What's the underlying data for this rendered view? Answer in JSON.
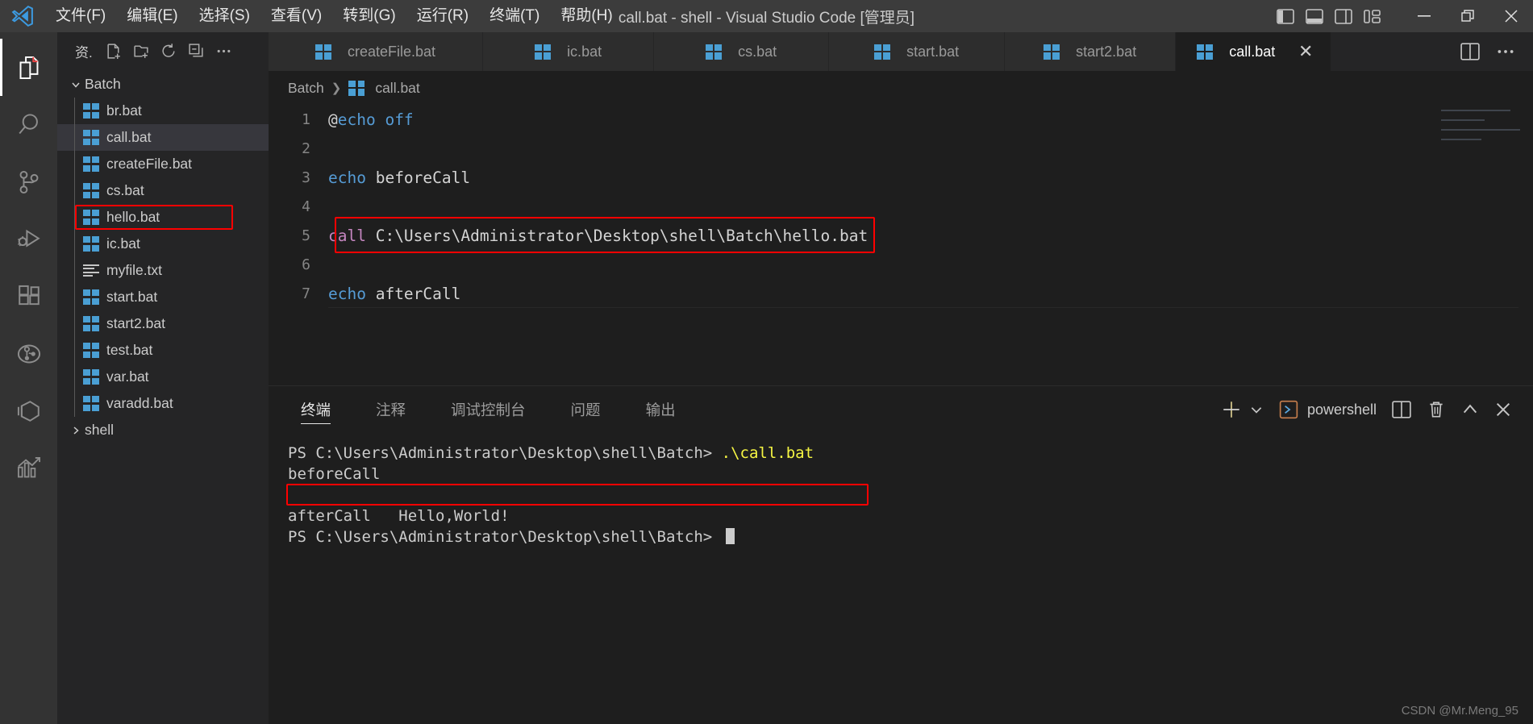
{
  "window": {
    "title": "call.bat - shell - Visual Studio Code [管理员]",
    "logo_icon": "vscode-logo-icon",
    "menus": [
      {
        "label": "文件(F)",
        "name": "menu-file"
      },
      {
        "label": "编辑(E)",
        "name": "menu-edit"
      },
      {
        "label": "选择(S)",
        "name": "menu-selection"
      },
      {
        "label": "查看(V)",
        "name": "menu-view"
      },
      {
        "label": "转到(G)",
        "name": "menu-go"
      },
      {
        "label": "运行(R)",
        "name": "menu-run"
      },
      {
        "label": "终端(T)",
        "name": "menu-terminal"
      },
      {
        "label": "帮助(H)",
        "name": "menu-help"
      }
    ],
    "layout_controls": [
      "toggle-primary-sidebar-icon",
      "toggle-panel-icon",
      "toggle-secondary-sidebar-icon",
      "customize-layout-icon"
    ],
    "window_controls": {
      "minimize": "−",
      "restore": "❐",
      "close": "✕"
    }
  },
  "activitybar": {
    "items": [
      {
        "name": "activity-explorer",
        "icon": "files-icon",
        "active": true
      },
      {
        "name": "activity-search",
        "icon": "search-icon",
        "active": false
      },
      {
        "name": "activity-source-control",
        "icon": "source-control-icon",
        "active": false
      },
      {
        "name": "activity-run-debug",
        "icon": "run-and-debug-icon",
        "active": false
      },
      {
        "name": "activity-extensions",
        "icon": "extensions-icon",
        "active": false
      },
      {
        "name": "activity-testing",
        "icon": "beaker-circle-icon",
        "active": false
      },
      {
        "name": "activity-remote",
        "icon": "cube-icon",
        "active": false
      },
      {
        "name": "activity-analytics",
        "icon": "graph-chart-icon",
        "active": false
      }
    ]
  },
  "sidebar": {
    "title": "资.",
    "actions": [
      {
        "name": "new-file-button",
        "icon": "new-file-icon"
      },
      {
        "name": "new-folder-button",
        "icon": "new-folder-icon"
      },
      {
        "name": "refresh-explorer-button",
        "icon": "refresh-icon"
      },
      {
        "name": "collapse-folders-button",
        "icon": "collapse-all-icon"
      },
      {
        "name": "explorer-more-actions-button",
        "icon": "ellipsis-icon"
      }
    ],
    "tree": [
      {
        "label": "Batch",
        "type": "folder",
        "expanded": true,
        "icon": "chevron-down-icon"
      },
      {
        "label": "br.bat",
        "type": "file",
        "icon": "bat-file-icon"
      },
      {
        "label": "call.bat",
        "type": "file",
        "icon": "bat-file-icon",
        "selected": true
      },
      {
        "label": "createFile.bat",
        "type": "file",
        "icon": "bat-file-icon"
      },
      {
        "label": "cs.bat",
        "type": "file",
        "icon": "bat-file-icon"
      },
      {
        "label": "hello.bat",
        "type": "file",
        "icon": "bat-file-icon",
        "highlighted": true
      },
      {
        "label": "ic.bat",
        "type": "file",
        "icon": "bat-file-icon"
      },
      {
        "label": "myfile.txt",
        "type": "file",
        "icon": "text-file-icon"
      },
      {
        "label": "start.bat",
        "type": "file",
        "icon": "bat-file-icon"
      },
      {
        "label": "start2.bat",
        "type": "file",
        "icon": "bat-file-icon"
      },
      {
        "label": "test.bat",
        "type": "file",
        "icon": "bat-file-icon"
      },
      {
        "label": "var.bat",
        "type": "file",
        "icon": "bat-file-icon"
      },
      {
        "label": "varadd.bat",
        "type": "file",
        "icon": "bat-file-icon"
      },
      {
        "label": "shell",
        "type": "folder",
        "expanded": false,
        "icon": "chevron-right-icon"
      }
    ]
  },
  "editor": {
    "tabs": [
      {
        "label": "createFile.bat",
        "icon": "bat-file-icon",
        "active": false
      },
      {
        "label": "ic.bat",
        "icon": "bat-file-icon",
        "active": false
      },
      {
        "label": "cs.bat",
        "icon": "bat-file-icon",
        "active": false
      },
      {
        "label": "start.bat",
        "icon": "bat-file-icon",
        "active": false
      },
      {
        "label": "start2.bat",
        "icon": "bat-file-icon",
        "active": false
      },
      {
        "label": "call.bat",
        "icon": "bat-file-icon",
        "active": true,
        "close": "✕"
      }
    ],
    "tab_actions": [
      {
        "name": "split-editor-button",
        "icon": "split-editor-icon"
      },
      {
        "name": "editor-more-actions-button",
        "icon": "ellipsis-icon"
      }
    ],
    "breadcrumb": {
      "folder": "Batch",
      "separator": "❯",
      "file": "call.bat",
      "file_icon": "bat-file-icon"
    },
    "lines": [
      {
        "num": "1",
        "segments": [
          {
            "text": "@",
            "cls": "plain"
          },
          {
            "text": "echo off",
            "cls": "kw-blue"
          }
        ]
      },
      {
        "num": "2",
        "segments": [
          {
            "text": "",
            "cls": "plain"
          }
        ]
      },
      {
        "num": "3",
        "segments": [
          {
            "text": "echo",
            "cls": "kw-blue"
          },
          {
            "text": " beforeCall",
            "cls": "plain"
          }
        ]
      },
      {
        "num": "4",
        "segments": [
          {
            "text": "",
            "cls": "plain"
          }
        ]
      },
      {
        "num": "5",
        "segments": [
          {
            "text": "call",
            "cls": "kw-pink"
          },
          {
            "text": " C:\\Users\\Administrator\\Desktop\\shell\\Batch\\hello.bat",
            "cls": "plain"
          }
        ],
        "highlighted": true
      },
      {
        "num": "6",
        "segments": [
          {
            "text": "",
            "cls": "plain"
          }
        ]
      },
      {
        "num": "7",
        "segments": [
          {
            "text": "echo",
            "cls": "kw-blue"
          },
          {
            "text": " afterCall",
            "cls": "plain"
          }
        ]
      }
    ]
  },
  "panel": {
    "tabs": [
      {
        "label": "终端",
        "name": "panel-tab-terminal",
        "active": true
      },
      {
        "label": "注释",
        "name": "panel-tab-comments",
        "active": false
      },
      {
        "label": "调试控制台",
        "name": "panel-tab-debug-console",
        "active": false
      },
      {
        "label": "问题",
        "name": "panel-tab-problems",
        "active": false
      },
      {
        "label": "输出",
        "name": "panel-tab-output",
        "active": false
      }
    ],
    "actions": {
      "new_terminal": "+",
      "new_terminal_dropdown": "chevron-down-icon",
      "shell_icon": "terminal-powershell-icon",
      "shell_name": "powershell",
      "split_terminal": "split-terminal-icon",
      "kill_terminal": "trash-icon",
      "maximize_panel": "chevron-up-icon",
      "close_panel": "✕"
    },
    "terminal_lines": [
      {
        "segments": [
          {
            "text": "PS C:\\Users\\Administrator\\Desktop\\shell\\Batch> ",
            "cls": ""
          },
          {
            "text": ".\\call.bat",
            "cls": "t-yellow"
          }
        ]
      },
      {
        "segments": [
          {
            "text": "beforeCall",
            "cls": ""
          }
        ]
      },
      {
        "segments": [
          {
            "text": "Hello,World!",
            "cls": ""
          }
        ],
        "highlighted": true
      },
      {
        "segments": [
          {
            "text": "afterCall",
            "cls": ""
          }
        ]
      },
      {
        "segments": [
          {
            "text": "PS C:\\Users\\Administrator\\Desktop\\shell\\Batch> ",
            "cls": ""
          }
        ],
        "cursor": true
      }
    ]
  },
  "watermark": "CSDN @Mr.Meng_95",
  "colors": {
    "accent_red": "#ff0000",
    "keyword_blue": "#569cd6",
    "keyword_pink": "#c586c0",
    "terminal_yellow": "#f5f543",
    "bat_icon_blue": "#4a9fd4"
  }
}
